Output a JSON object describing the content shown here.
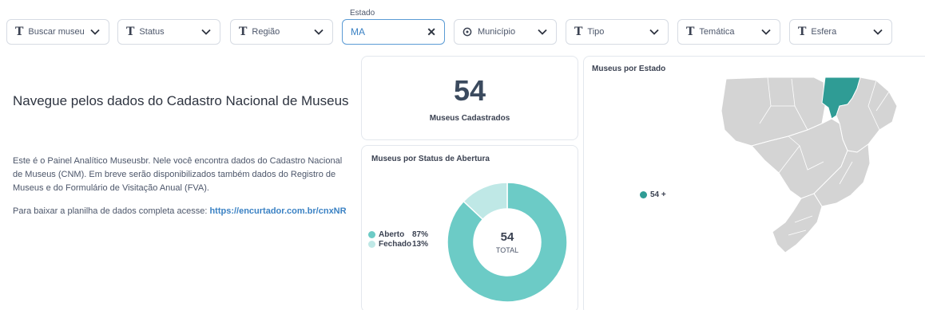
{
  "filters": {
    "buscar": {
      "label": "Buscar museu",
      "icon": "text-type-icon"
    },
    "status": {
      "label": "Status",
      "icon": "text-type-icon"
    },
    "regiao": {
      "label": "Região",
      "icon": "text-type-icon"
    },
    "estado": {
      "floating_label": "Estado",
      "value": "MA"
    },
    "municipio": {
      "label": "Município",
      "icon": "map-pin-icon"
    },
    "tipo": {
      "label": "Tipo",
      "icon": "text-type-icon"
    },
    "tematica": {
      "label": "Temática",
      "icon": "text-type-icon"
    },
    "esfera": {
      "label": "Esfera",
      "icon": "text-type-icon"
    }
  },
  "intro": {
    "title": "Navegue pelos dados do Cadastro Nacional de Museus",
    "paragraph": "Este é o Painel Analítico Museusbr. Nele você encontra dados do Cadastro Nacional de Museus (CNM). Em breve serão disponibilizados também dados do Registro de Museus e do Formulário de Visitação Anual (FVA).",
    "download_prefix": "Para baixar a planilha de dados completa acesse: ",
    "download_link": "https://encurtador.com.br/cnxNR"
  },
  "count_card": {
    "value": "54",
    "label": "Museus Cadastrados"
  },
  "status_card": {
    "title": "Museus por Status de Abertura"
  },
  "map_card": {
    "title": "Museus por Estado",
    "legend_label": "54 +"
  },
  "colors": {
    "accent": "#5b9bd5",
    "aberto": "#6ccbc6",
    "fechado": "#bfe8e6",
    "map_highlight": "#2f9c95",
    "map_base": "#d4d4d4"
  },
  "chart_data": {
    "type": "pie",
    "title": "Museus por Status de Abertura",
    "categories": [
      "Aberto",
      "Fechado"
    ],
    "values": [
      87,
      13
    ],
    "labels": [
      "87%",
      "13%"
    ],
    "center_value": "54",
    "center_label": "TOTAL",
    "legend": "left"
  }
}
